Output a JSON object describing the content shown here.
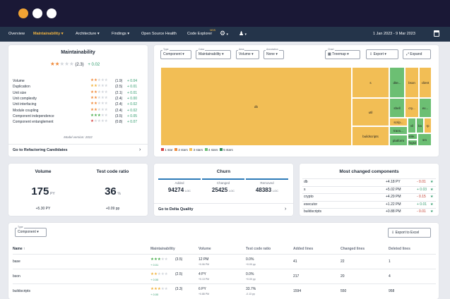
{
  "nav": {
    "items": [
      "Overview",
      "Maintainability",
      "Architecture",
      "Findings",
      "Open Source Health",
      "Code Explorer"
    ],
    "badge": "NEW",
    "date_range": "1 Jan 2023 - 9 Mar 2023"
  },
  "colors": {
    "accent": "#f2b441",
    "navbar": "#24344a",
    "titlebar": "#1a1836",
    "green": "#2e9a6b",
    "red": "#c0392b"
  },
  "maint": {
    "title": "Maintainability",
    "score": "(2.3)",
    "score_stars": 2.3,
    "delta": "+ 0.02",
    "metrics": [
      {
        "name": "Volume",
        "score": "(1.9)",
        "stars": 1.9,
        "delta": "+ 0.04"
      },
      {
        "name": "Duplication",
        "score": "(2.5)",
        "stars": 2.5,
        "delta": "+ 0.01"
      },
      {
        "name": "Unit size",
        "score": "(2.1)",
        "stars": 2.1,
        "delta": "+ 0.01"
      },
      {
        "name": "Unit complexity",
        "score": "(2.4)",
        "stars": 2.4,
        "delta": "+ 0.00"
      },
      {
        "name": "Unit interfacing",
        "score": "(2.4)",
        "stars": 2.4,
        "delta": "+ 0.02"
      },
      {
        "name": "Module coupling",
        "score": "(2.4)",
        "stars": 2.4,
        "delta": "+ 0.02"
      },
      {
        "name": "Component independence",
        "score": "(3.5)",
        "stars": 3.5,
        "delta": "+ 0.05"
      },
      {
        "name": "Component entanglement",
        "score": "(0.8)",
        "stars": 0.8,
        "delta": "+ 0.07"
      }
    ],
    "model": "Model version: 2022",
    "link": "Go to Refactoring Candidates"
  },
  "treemap": {
    "type_label": "Type",
    "type": "Component",
    "color_label": "Color",
    "color": "Maintainability",
    "area_label": "Area",
    "area": "Volume",
    "annotation_label": "Annotation",
    "annotation": "None",
    "chart_label": "Chart",
    "chart": "Treemap",
    "export": "Export",
    "expand": "Expand",
    "cells": [
      "db",
      "s",
      "util",
      "buildscripts",
      "dite...",
      "bson",
      "client",
      "cry...",
      "shell",
      "ex...",
      "scrip...",
      "vil",
      "ba",
      "rp",
      "trans...",
      "stile...",
      "fogs2",
      "platform",
      "sm"
    ],
    "legend": [
      "1 star",
      "2 stars",
      "3 stars",
      "4 stars",
      "5 stars"
    ]
  },
  "volume": {
    "title": "Volume",
    "value": "175",
    "unit": "PY",
    "delta": "+5.30 PY"
  },
  "testratio": {
    "title": "Test code ratio",
    "value": "36",
    "unit": "%",
    "delta": "+0.09 pp"
  },
  "churn": {
    "title": "Churn",
    "added_label": "Added",
    "added": "94274",
    "changed_label": "Changed",
    "changed": "25425",
    "removed_label": "Removed",
    "removed": "48383",
    "unit": "LOC",
    "link": "Go to Delta Quality"
  },
  "changed": {
    "title": "Most changed components",
    "rows": [
      {
        "name": "db",
        "volume": "+4.18 PY",
        "delta": "- 0.01",
        "dir": "down"
      },
      {
        "name": "s",
        "volume": "+5.02 PM",
        "delta": "+ 0.03",
        "dir": "up"
      },
      {
        "name": "crypto",
        "volume": "+4.29 PM",
        "delta": "- 0.15",
        "dir": "down"
      },
      {
        "name": "executor",
        "volume": "+1.22 PM",
        "delta": "+ 0.01",
        "dir": "up"
      },
      {
        "name": "buildscripts",
        "volume": "+0.88 PM",
        "delta": "- 0.01",
        "dir": "down"
      }
    ]
  },
  "table": {
    "type_label": "Type",
    "type": "Component",
    "export": "Export to Excel",
    "headers": [
      "Name",
      "Maintainability",
      "Volume",
      "Test code ratio",
      "Added lines",
      "Changed lines",
      "Deleted lines"
    ],
    "rows": [
      {
        "name": "base",
        "score": "(3.5)",
        "stars": 3.5,
        "mdelta": "+ 0.01",
        "volume": "12 PM",
        "vdelta": "+0.06 PM",
        "ratio": "0.0%",
        "rdelta": "+0.00 pp",
        "added": "41",
        "changed": "22",
        "deleted": "1"
      },
      {
        "name": "bson",
        "score": "(2.5)",
        "stars": 2.5,
        "mdelta": "+ 0.00",
        "volume": "4 PY",
        "vdelta": "+0.13 PM",
        "ratio": "0.0%",
        "rdelta": "+0.00 pp",
        "added": "217",
        "changed": "20",
        "deleted": "4"
      },
      {
        "name": "buildscripts",
        "score": "(3.3)",
        "stars": 3.3,
        "mdelta": "+ 0.00",
        "volume": "6 PY",
        "vdelta": "+0.88 PM",
        "ratio": "33.7%",
        "rdelta": "-0.13 pp",
        "added": "1594",
        "changed": "550",
        "deleted": "958"
      }
    ]
  }
}
